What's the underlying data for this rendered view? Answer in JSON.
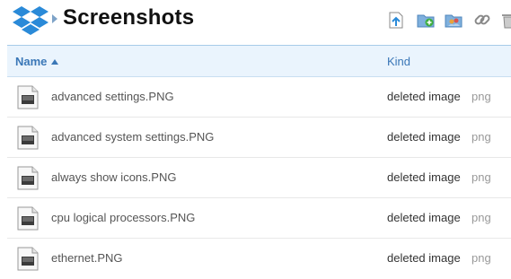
{
  "breadcrumb": {
    "title": "Screenshots",
    "logo_icon": "dropbox-logo",
    "separator_icon": "triangle-right-icon"
  },
  "toolbar": [
    {
      "name": "upload-button",
      "icon": "upload-icon"
    },
    {
      "name": "new-folder-button",
      "icon": "new-folder-icon"
    },
    {
      "name": "shared-folder-button",
      "icon": "shared-folder-icon"
    },
    {
      "name": "share-link-button",
      "icon": "link-icon"
    },
    {
      "name": "delete-button",
      "icon": "trash-icon"
    }
  ],
  "columns": {
    "name": "Name",
    "kind": "Kind"
  },
  "files": [
    {
      "name": "advanced settings.PNG",
      "kind": "deleted image",
      "ext": "png"
    },
    {
      "name": "advanced system settings.PNG",
      "kind": "deleted image",
      "ext": "png"
    },
    {
      "name": "always show icons.PNG",
      "kind": "deleted image",
      "ext": "png"
    },
    {
      "name": "cpu logical processors.PNG",
      "kind": "deleted image",
      "ext": "png"
    },
    {
      "name": "ethernet.PNG",
      "kind": "deleted image",
      "ext": "png"
    }
  ],
  "colors": {
    "accent": "#3a77b7",
    "header_bg": "#eaf4fd",
    "logo_blue": "#2a8ad8"
  }
}
